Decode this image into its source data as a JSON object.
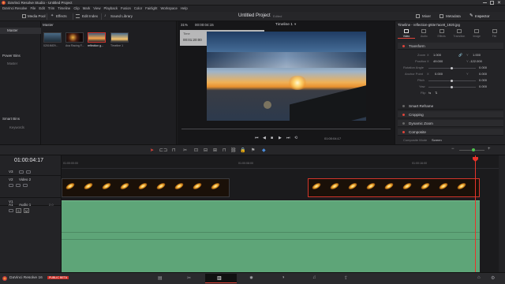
{
  "window": {
    "title": "DaVinci Resolve Studio - Untitled Project",
    "controls": [
      "minimize",
      "maximize",
      "close"
    ]
  },
  "menu": [
    "DaVinci Resolve",
    "File",
    "Edit",
    "Trim",
    "Timeline",
    "Clip",
    "Mark",
    "View",
    "Playback",
    "Fusion",
    "Color",
    "Fairlight",
    "Workspace",
    "Help"
  ],
  "toolbar": {
    "media_pool": "Media Pool",
    "effects": "Effects",
    "edit_index": "Edit Index",
    "sound_library": "Sound Library",
    "project_title": "Untitled Project",
    "project_state": "Edited",
    "mixer": "Mixer",
    "metadata": "Metadata",
    "inspector": "Inspector"
  },
  "bins": {
    "master": "Master",
    "power_bins": "Power Bins",
    "power_master": "Master",
    "smart_bins": "Smart Bins",
    "keywords": "Keywords"
  },
  "media": {
    "bin_name": "Master",
    "items": [
      {
        "label": "0201f6f29..."
      },
      {
        "label": "Ava Racing F..."
      },
      {
        "label": "reflection g..."
      },
      {
        "label": "Timeline 1"
      }
    ]
  },
  "viewer": {
    "zoom": "31%",
    "timecode_top": "00:00:04:15",
    "timeline_name": "Timeline 1",
    "marker_time_label": "Time",
    "marker_time_value": "00:01:20:00",
    "marker_name_label": "Name",
    "marker_name_value": "Marker 1",
    "playback_timecode": "01:00:04:17"
  },
  "inspector": {
    "clip_title": "Timeline - reflection-g93e7ace8_1920.jpg",
    "tabs": [
      "Video",
      "Audio",
      "Effects",
      "Transition",
      "Image",
      "File"
    ],
    "transform": "Transform",
    "zoom_label": "Zoom",
    "zoom_x": "1.000",
    "zoom_y": "1.000",
    "position_label": "Position",
    "position_x": "49.000",
    "position_y": "-122.000",
    "rotation_label": "Rotation Angle",
    "rotation_value": "0.000",
    "anchor_label": "Anchor Point",
    "anchor_x": "0.000",
    "anchor_y": "0.000",
    "pitch_label": "Pitch",
    "pitch_value": "0.000",
    "yaw_label": "Yaw",
    "yaw_value": "0.000",
    "flip_label": "Flip",
    "smart_reframe": "Smart Reframe",
    "cropping": "Cropping",
    "dynamic_zoom": "Dynamic Zoom",
    "composite": "Composite",
    "composite_mode_label": "Composite Mode",
    "composite_mode_value": "Screen"
  },
  "timeline": {
    "current_timecode": "01:00:04:17",
    "ruler_marks": [
      "01:00:00:00",
      "01:00:08:00",
      "01:00:16:00"
    ],
    "tracks": [
      {
        "id": "V3",
        "name": ""
      },
      {
        "id": "V2",
        "name": "Video 2"
      },
      {
        "id": "V1",
        "name": ""
      },
      {
        "id": "A1",
        "name": "Audio 1",
        "level": "2.0"
      }
    ]
  },
  "status": {
    "app": "DaVinci Resolve 16",
    "badge": "PUBLIC BETA"
  },
  "colors": {
    "accent_red": "#e0443a",
    "selection_red": "#d2352c",
    "audio_green": "#5ea578",
    "playhead": "#e8332a"
  },
  "icons": {
    "pages": [
      "media-icon",
      "cut-icon",
      "edit-icon",
      "fusion-icon",
      "color-icon",
      "fairlight-icon",
      "deliver-icon"
    ]
  }
}
